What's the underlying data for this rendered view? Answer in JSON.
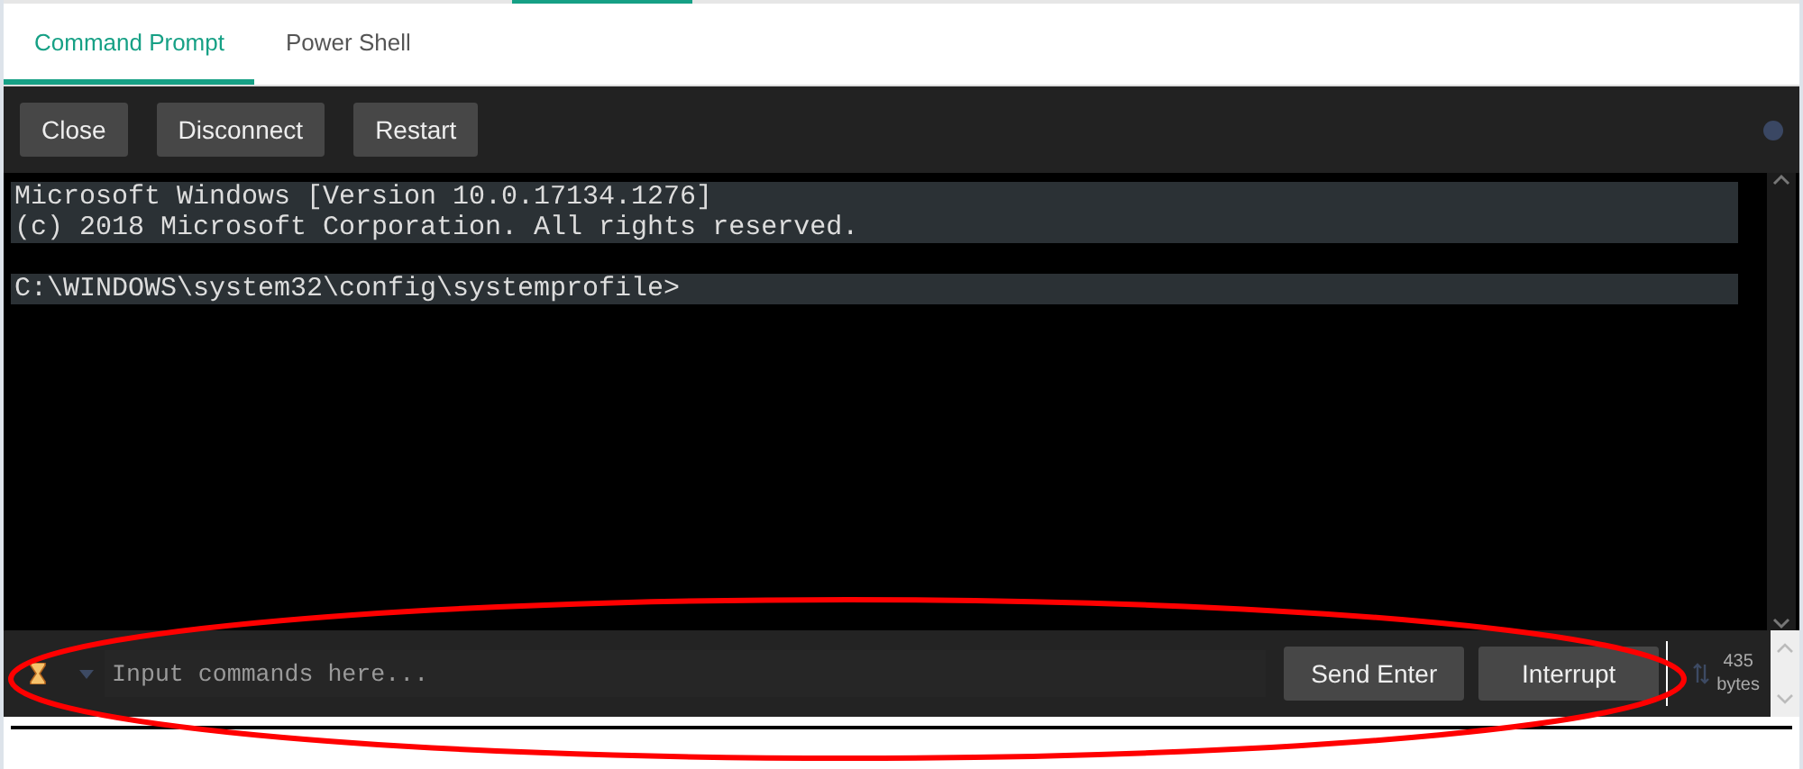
{
  "tabs": [
    {
      "label": "Command Prompt",
      "selected": true
    },
    {
      "label": "Power Shell",
      "selected": false
    }
  ],
  "toolbar": {
    "buttons": [
      "Close",
      "Disconnect",
      "Restart"
    ]
  },
  "terminal": {
    "blocks": [
      [
        "Microsoft Windows [Version 10.0.17134.1276]",
        "(c) 2018 Microsoft Corporation. All rights reserved."
      ],
      [
        "C:\\WINDOWS\\system32\\config\\systemprofile>"
      ]
    ]
  },
  "input_bar": {
    "placeholder": "Input commands here...",
    "buttons": [
      "Send Enter",
      "Interrupt"
    ],
    "byte_count": "435",
    "byte_unit": "bytes"
  }
}
